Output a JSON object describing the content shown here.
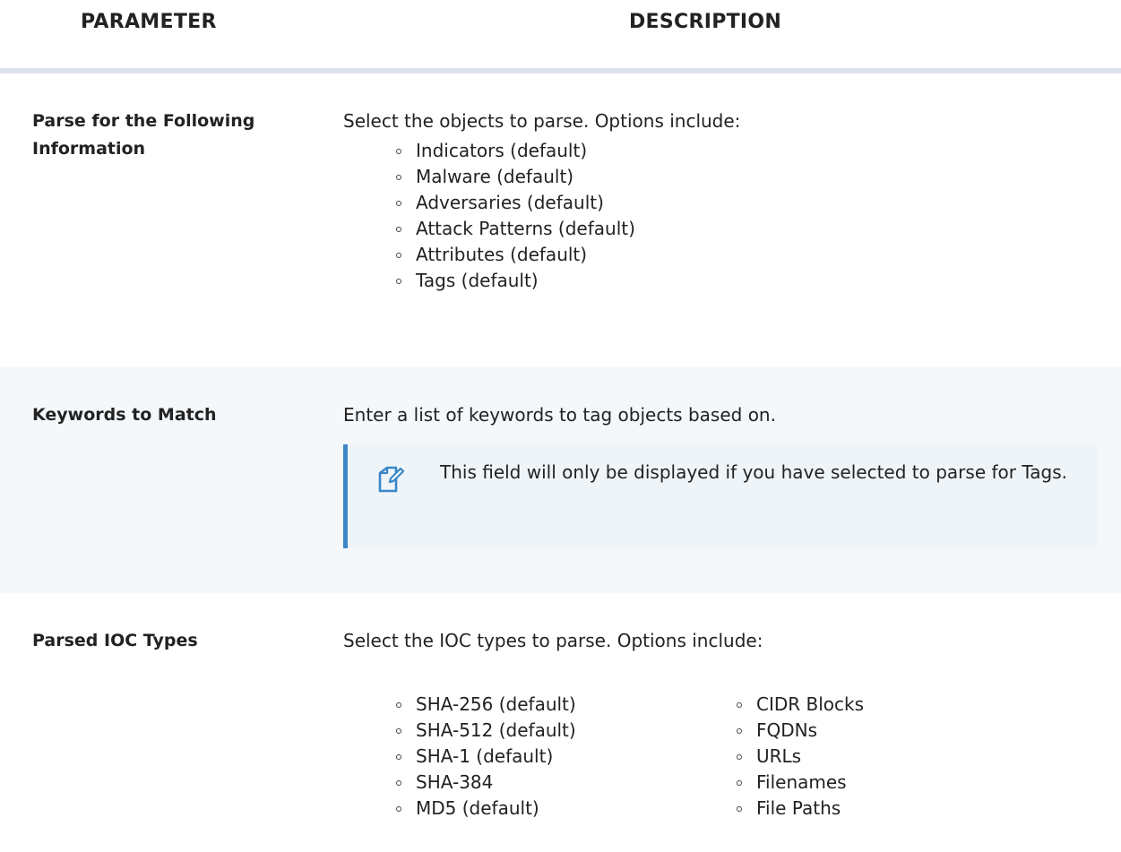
{
  "header": {
    "parameter_label": "PARAMETER",
    "description_label": "DESCRIPTION"
  },
  "rows": [
    {
      "parameter": "Parse for the Following Information",
      "description": "Select the objects to parse.  Options include:",
      "options": [
        "Indicators (default)",
        "Malware (default)",
        "Adversaries (default)",
        "Attack Patterns (default)",
        "Attributes (default)",
        "Tags (default)"
      ]
    },
    {
      "parameter": "Keywords to Match",
      "description": "Enter a list of keywords to tag objects based on.",
      "note": {
        "icon": "note-icon",
        "text": "This field will only be displayed if you have selected to parse for Tags."
      }
    },
    {
      "parameter": "Parsed IOC Types",
      "description": "Select the IOC types to parse.  Options include:",
      "options_col_a": [
        "SHA-256 (default)",
        "SHA-512 (default)",
        "SHA-1 (default)",
        "SHA-384",
        "MD5 (default)"
      ],
      "options_col_b": [
        "CIDR Blocks",
        "FQDNs",
        "URLs",
        "Filenames",
        "File Paths"
      ]
    }
  ],
  "colors": {
    "header_divider": "#dde3ee",
    "shaded_row": "#f4f8fb",
    "note_background": "#eef4f8",
    "note_accent": "#3a86c8"
  }
}
